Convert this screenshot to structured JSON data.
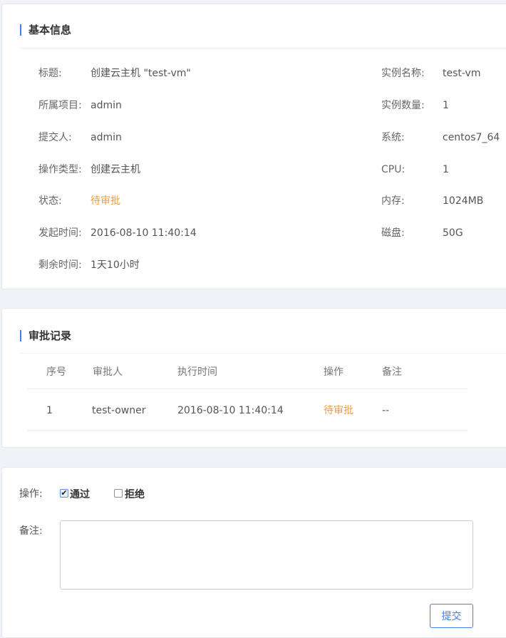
{
  "basic_info": {
    "title": "基本信息",
    "left": [
      {
        "label": "标题:",
        "value": "创建云主机 \"test-vm\""
      },
      {
        "label": "所属项目:",
        "value": "admin"
      },
      {
        "label": "提交人:",
        "value": "admin"
      },
      {
        "label": "操作类型:",
        "value": "创建云主机"
      },
      {
        "label": "状态:",
        "value": "待审批"
      },
      {
        "label": "发起时间:",
        "value": "2016-08-10 11:40:14"
      },
      {
        "label": "剩余时间:",
        "value": "1天10小时"
      }
    ],
    "right": [
      {
        "label": "实例名称:",
        "value": "test-vm"
      },
      {
        "label": "实例数量:",
        "value": "1"
      },
      {
        "label": "系统:",
        "value": "centos7_64"
      },
      {
        "label": "CPU:",
        "value": "1"
      },
      {
        "label": "内存:",
        "value": "1024MB"
      },
      {
        "label": "磁盘:",
        "value": "50G"
      }
    ]
  },
  "approval_records": {
    "title": "审批记录",
    "columns": [
      "序号",
      "审批人",
      "执行时间",
      "操作",
      "备注"
    ],
    "rows": [
      [
        "1",
        "test-owner",
        "2016-08-10 11:40:14",
        "待审批",
        "--"
      ]
    ]
  },
  "action_form": {
    "operation_label": "操作:",
    "approve_label": "通过",
    "approve_checked": true,
    "reject_label": "拒绝",
    "reject_checked": false,
    "remark_label": "备注:",
    "remark_value": "",
    "submit_label": "提交"
  },
  "colors": {
    "accent": "#3f7ff0",
    "pending": "#f39b3c"
  }
}
